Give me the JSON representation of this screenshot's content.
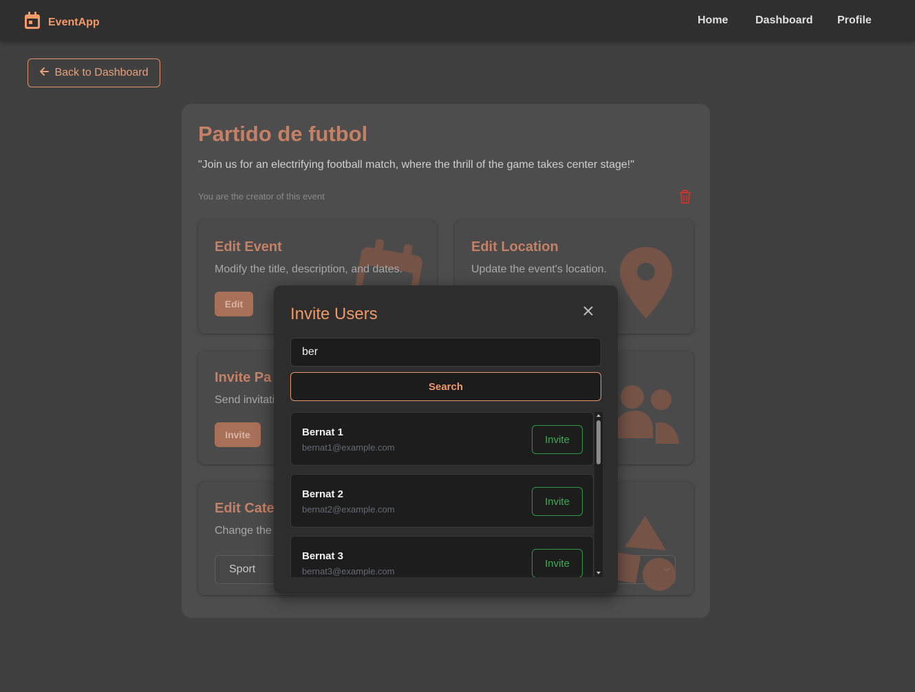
{
  "navbar": {
    "brand": "EventApp",
    "links": [
      "Home",
      "Dashboard",
      "Profile"
    ]
  },
  "back_button": "Back to Dashboard",
  "event": {
    "title": "Partido de futbol",
    "description": "\"Join us for an electrifying football match, where the thrill of the game takes center stage!\"",
    "creator_note": "You are the creator of this event"
  },
  "cards": {
    "edit_event": {
      "title": "Edit Event",
      "desc": "Modify the title, description, and dates.",
      "button": "Edit"
    },
    "edit_location": {
      "title": "Edit Location",
      "desc": "Update the event's location."
    },
    "invite": {
      "title": "Invite Pa",
      "desc": "Send invitati",
      "button": "Invite"
    },
    "category": {
      "title": "Edit Cate",
      "desc": "Change the",
      "selected": "Sport"
    }
  },
  "modal": {
    "title": "Invite Users",
    "search_value": "ber",
    "search_button": "Search",
    "results": [
      {
        "name": "Bernat 1",
        "email": "bernat1@example.com",
        "button": "Invite"
      },
      {
        "name": "Bernat 2",
        "email": "bernat2@example.com",
        "button": "Invite"
      },
      {
        "name": "Bernat 3",
        "email": "bernat3@example.com",
        "button": "Invite"
      }
    ]
  },
  "colors": {
    "background": "#404040",
    "accent": "#ef9868",
    "invite_green": "#3aae52",
    "delete_red": "#c0392b"
  }
}
